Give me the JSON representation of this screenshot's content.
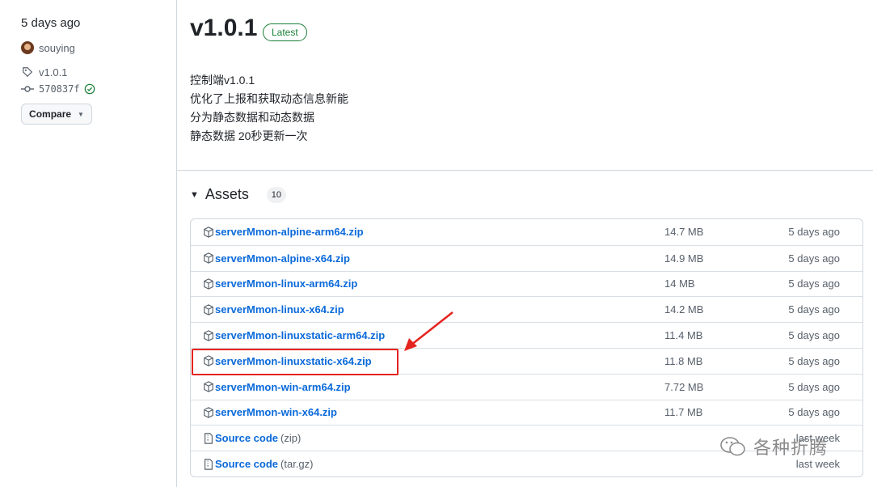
{
  "sidebar": {
    "time": "5 days ago",
    "author": "souying",
    "tag": "v1.0.1",
    "commit": "570837f",
    "compare_label": "Compare"
  },
  "release": {
    "title": "v1.0.1",
    "badge": "Latest",
    "notes": [
      "控制端v1.0.1",
      "优化了上报和获取动态信息新能",
      "分为静态数据和动态数据",
      "静态数据 20秒更新一次"
    ]
  },
  "assets": {
    "heading": "Assets",
    "count": "10",
    "items": [
      {
        "name": "serverMmon-alpine-arm64.zip",
        "ext": "",
        "size": "14.7 MB",
        "date": "5 days ago"
      },
      {
        "name": "serverMmon-alpine-x64.zip",
        "ext": "",
        "size": "14.9 MB",
        "date": "5 days ago"
      },
      {
        "name": "serverMmon-linux-arm64.zip",
        "ext": "",
        "size": "14 MB",
        "date": "5 days ago"
      },
      {
        "name": "serverMmon-linux-x64.zip",
        "ext": "",
        "size": "14.2 MB",
        "date": "5 days ago"
      },
      {
        "name": "serverMmon-linuxstatic-arm64.zip",
        "ext": "",
        "size": "11.4 MB",
        "date": "5 days ago"
      },
      {
        "name": "serverMmon-linuxstatic-x64.zip",
        "ext": "",
        "size": "11.8 MB",
        "date": "5 days ago"
      },
      {
        "name": "serverMmon-win-arm64.zip",
        "ext": "",
        "size": "7.72 MB",
        "date": "5 days ago"
      },
      {
        "name": "serverMmon-win-x64.zip",
        "ext": "",
        "size": "11.7 MB",
        "date": "5 days ago"
      },
      {
        "name": "Source code",
        "ext": "(zip)",
        "size": "",
        "date": "last week"
      },
      {
        "name": "Source code",
        "ext": "(tar.gz)",
        "size": "",
        "date": "last week"
      }
    ]
  },
  "watermark": {
    "text": "各种折腾"
  },
  "colors": {
    "accent": "#0969da",
    "latest": "#1a7f37",
    "highlight": "#e4241f"
  },
  "icons": {
    "tag": "tag-icon",
    "commit": "git-commit-icon",
    "verified": "check-circle-icon",
    "package": "package-icon",
    "source": "file-zip-icon"
  }
}
